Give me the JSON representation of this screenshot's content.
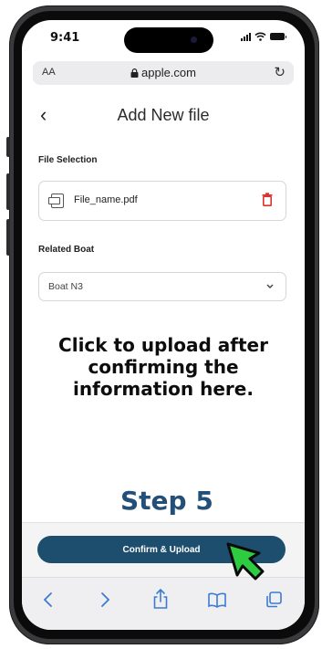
{
  "status_bar": {
    "time": "9:41"
  },
  "browser": {
    "text_size_label": "AA",
    "url": "apple.com",
    "reload_glyph": "↻"
  },
  "app": {
    "back_glyph": "‹",
    "title": "Add New file",
    "file_selection": {
      "label": "File Selection",
      "file_name": "File_name.pdf"
    },
    "related_boat": {
      "label": "Related Boat",
      "selected_value": "Boat N3"
    },
    "confirm_label": "Confirm & Upload"
  },
  "tutorial": {
    "instruction": "Click to upload after confirming the information here.",
    "step": "Step 5",
    "cursor_color": "#2ecc40"
  },
  "colors": {
    "primary": "#1d4e6e",
    "step_text": "#234f78",
    "delete_icon": "#e03131"
  },
  "safari_toolbar": {
    "icons": [
      "back-icon",
      "forward-icon",
      "share-icon",
      "bookmarks-icon",
      "tabs-icon"
    ]
  }
}
